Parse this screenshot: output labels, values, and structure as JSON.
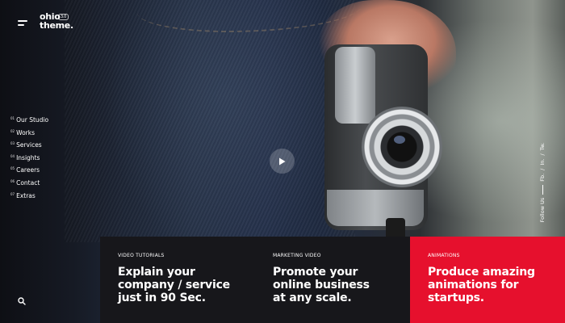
{
  "header": {
    "logo_line1": "ohio",
    "logo_line2": "theme.",
    "logo_badge": "3.0"
  },
  "nav": {
    "items": [
      {
        "num": "01",
        "label": "Our Studio"
      },
      {
        "num": "02",
        "label": "Works"
      },
      {
        "num": "03",
        "label": "Services"
      },
      {
        "num": "04",
        "label": "Insights"
      },
      {
        "num": "05",
        "label": "Careers"
      },
      {
        "num": "06",
        "label": "Contact"
      },
      {
        "num": "07",
        "label": "Extras"
      }
    ]
  },
  "social": {
    "follow_label": "Follow Us",
    "links": [
      "Fb.",
      "In.",
      "Tw."
    ],
    "separator": "/"
  },
  "cards": [
    {
      "kicker": "VIDEO TUTORIALS",
      "headline": "Explain your\ncompany / service\njust in 90 Sec.",
      "color": "#17171b"
    },
    {
      "kicker": "MARKETING VIDEO",
      "headline": "Promote your\nonline business\nat any scale.",
      "color": "#17171b"
    },
    {
      "kicker": "ANIMATIONS",
      "headline": "Produce amazing\nanimations for\nstartups.",
      "color": "#e6102d"
    }
  ],
  "icons": {
    "menu": "hamburger-icon",
    "search": "search-icon",
    "play": "play-icon"
  },
  "colors": {
    "accent": "#e6102d",
    "card_dark": "#17171b",
    "text": "#ffffff"
  }
}
